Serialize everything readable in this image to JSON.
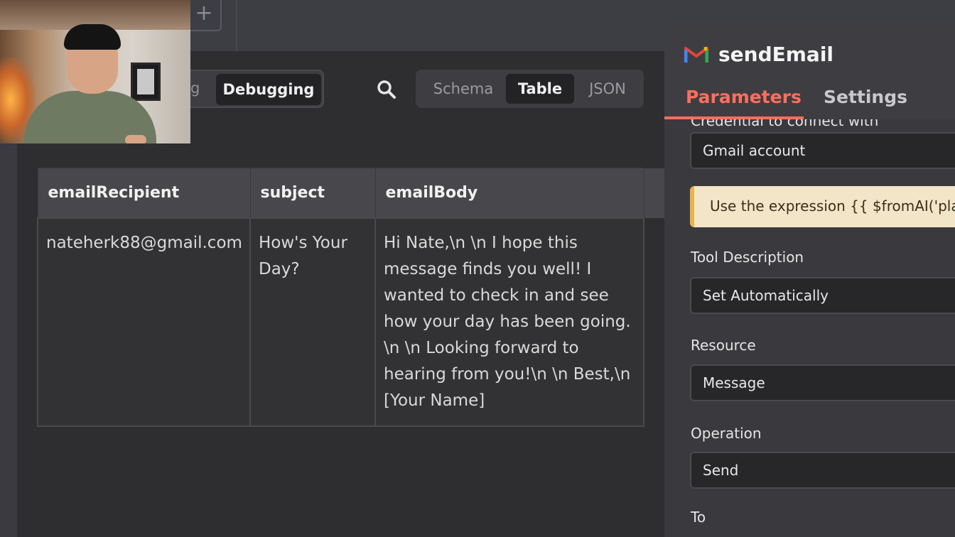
{
  "topbar": {
    "add_tab_label": "+"
  },
  "output": {
    "mode_toggle": {
      "partial_label": "g",
      "active_label": "Debugging"
    },
    "view_tabs": [
      "Schema",
      "Table",
      "JSON"
    ],
    "active_view": "Table",
    "table": {
      "columns": [
        "emailRecipient",
        "subject",
        "emailBody"
      ],
      "rows": [
        {
          "emailRecipient": "nateherk88@gmail.com",
          "subject": "How's Your Day?",
          "emailBody": "Hi Nate,\\n \\n I hope this message finds you well! I wanted to check in and see how your day has been going. \\n \\n Looking forward to hearing from you!\\n \\n Best,\\n [Your Name]"
        }
      ]
    }
  },
  "node_panel": {
    "title": "sendEmail",
    "tabs": [
      "Parameters",
      "Settings"
    ],
    "active_tab": "Parameters",
    "fields": {
      "credential": {
        "label": "Credential to connect with",
        "value": "Gmail account"
      },
      "notice": "Use the expression {{ $fromAI('plac",
      "tool_description": {
        "label": "Tool Description",
        "value": "Set Automatically"
      },
      "resource": {
        "label": "Resource",
        "value": "Message"
      },
      "operation": {
        "label": "Operation",
        "value": "Send"
      },
      "to": {
        "label": "To"
      }
    }
  },
  "colors": {
    "accent": "#ff6f5c",
    "notice_bg": "#f3e6c8",
    "notice_border": "#e8b24e"
  }
}
